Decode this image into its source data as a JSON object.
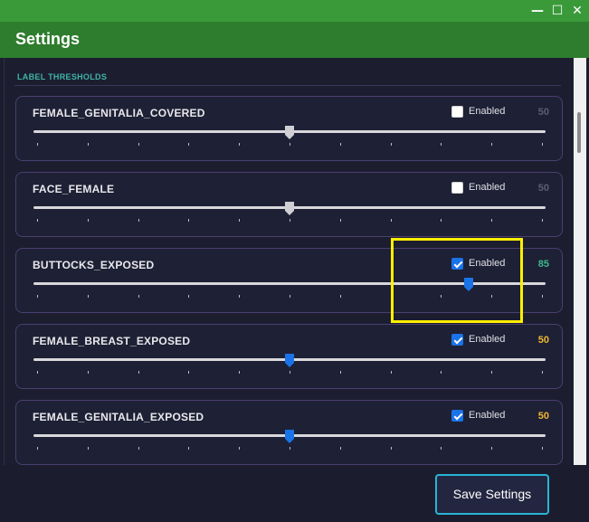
{
  "window": {
    "controls": [
      "—",
      "☐",
      "✕"
    ]
  },
  "header": {
    "title": "Settings"
  },
  "section": {
    "title": "LABEL THRESHOLDS"
  },
  "thresholds": [
    {
      "label": "FEMALE_GENITALIA_COVERED",
      "enabled": false,
      "enabled_label": "Enabled",
      "value": "50",
      "fraction": 0.5,
      "value_color": "#5c5e70",
      "thumb_color": "#cfcfd4"
    },
    {
      "label": "FACE_FEMALE",
      "enabled": false,
      "enabled_label": "Enabled",
      "value": "50",
      "fraction": 0.5,
      "value_color": "#5c5e70",
      "thumb_color": "#cfcfd4"
    },
    {
      "label": "BUTTOCKS_EXPOSED",
      "enabled": true,
      "enabled_label": "Enabled",
      "value": "85",
      "fraction": 0.85,
      "value_color": "#3fb98a",
      "thumb_color": "#1a73e8"
    },
    {
      "label": "FEMALE_BREAST_EXPOSED",
      "enabled": true,
      "enabled_label": "Enabled",
      "value": "50",
      "fraction": 0.5,
      "value_color": "#f0b632",
      "thumb_color": "#1a73e8"
    },
    {
      "label": "FEMALE_GENITALIA_EXPOSED",
      "enabled": true,
      "enabled_label": "Enabled",
      "value": "50",
      "fraction": 0.5,
      "value_color": "#f0b632",
      "thumb_color": "#1a73e8"
    }
  ],
  "footer": {
    "save_label": "Save Settings"
  },
  "colors": {
    "accent": "#1a73e8",
    "header": "#2e7d2e",
    "highlight": "#ffef00",
    "button_border": "#2ab4d4"
  }
}
